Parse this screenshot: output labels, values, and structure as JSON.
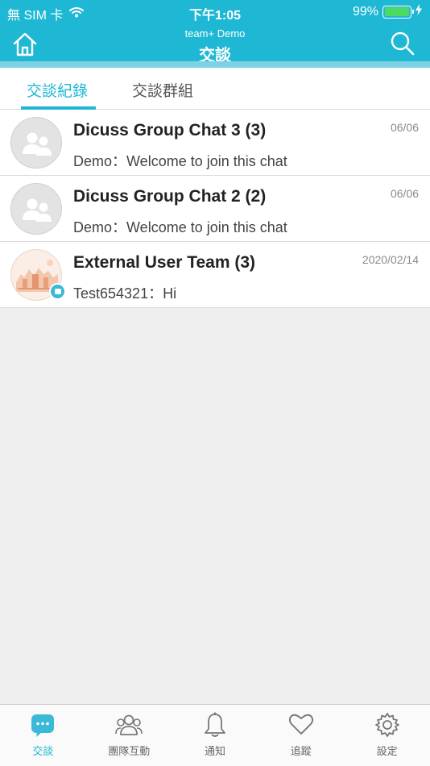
{
  "status": {
    "carrier": "無 SIM 卡",
    "time": "下午1:05",
    "battery": "99%",
    "battery_level": 0.99
  },
  "header": {
    "subtitle": "team+ Demo",
    "title": "交談",
    "icons": {
      "left": "home-icon",
      "right": "search-icon"
    }
  },
  "tabs": [
    {
      "label": "交談紀錄",
      "active": true
    },
    {
      "label": "交談群組",
      "active": false
    }
  ],
  "conversations": [
    {
      "title": "Dicuss Group Chat 3 (3)",
      "message": "Demo：Welcome to join this chat",
      "date": "06/06",
      "avatar": "group-avatar-icon"
    },
    {
      "title": "Dicuss Group Chat 2 (2)",
      "message": "Demo：Welcome to join this chat",
      "date": "06/06",
      "avatar": "group-avatar-icon"
    },
    {
      "title": "External User Team (3)",
      "message": "Test654321：Hi",
      "date": "2020/02/14",
      "avatar": "team-photo-avatar"
    }
  ],
  "bottom_nav": [
    {
      "label": "交談",
      "icon": "chat-bubble-icon",
      "active": true
    },
    {
      "label": "團隊互動",
      "icon": "team-people-icon",
      "active": false
    },
    {
      "label": "通知",
      "icon": "bell-icon",
      "active": false
    },
    {
      "label": "追蹤",
      "icon": "heart-icon",
      "active": false
    },
    {
      "label": "設定",
      "icon": "gear-icon",
      "active": false
    }
  ],
  "colors": {
    "accent": "#1fb8d4",
    "header_stripe": "#7dd2e1",
    "battery": "#4cd964",
    "background": "#efefef"
  }
}
